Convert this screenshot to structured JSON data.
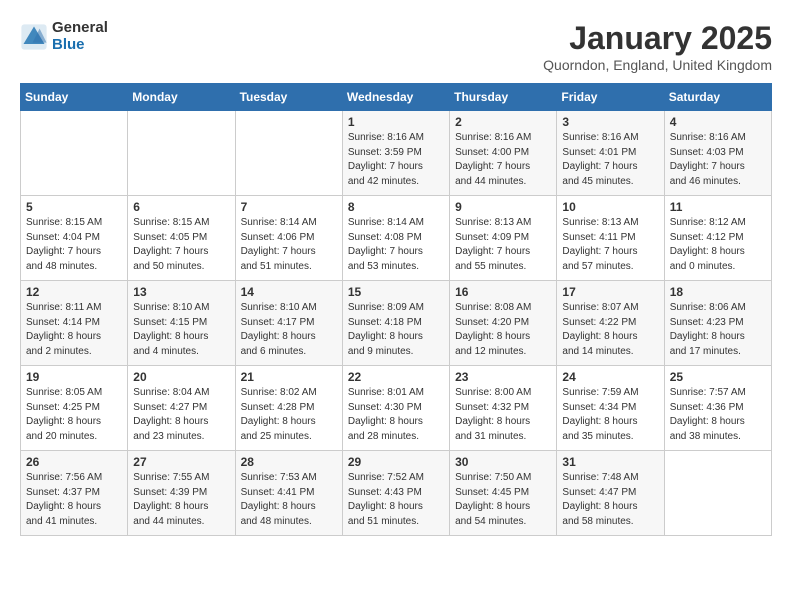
{
  "logo": {
    "general": "General",
    "blue": "Blue"
  },
  "title": "January 2025",
  "location": "Quorndon, England, United Kingdom",
  "days_of_week": [
    "Sunday",
    "Monday",
    "Tuesday",
    "Wednesday",
    "Thursday",
    "Friday",
    "Saturday"
  ],
  "weeks": [
    [
      {
        "day": "",
        "info": ""
      },
      {
        "day": "",
        "info": ""
      },
      {
        "day": "",
        "info": ""
      },
      {
        "day": "1",
        "info": "Sunrise: 8:16 AM\nSunset: 3:59 PM\nDaylight: 7 hours\nand 42 minutes."
      },
      {
        "day": "2",
        "info": "Sunrise: 8:16 AM\nSunset: 4:00 PM\nDaylight: 7 hours\nand 44 minutes."
      },
      {
        "day": "3",
        "info": "Sunrise: 8:16 AM\nSunset: 4:01 PM\nDaylight: 7 hours\nand 45 minutes."
      },
      {
        "day": "4",
        "info": "Sunrise: 8:16 AM\nSunset: 4:03 PM\nDaylight: 7 hours\nand 46 minutes."
      }
    ],
    [
      {
        "day": "5",
        "info": "Sunrise: 8:15 AM\nSunset: 4:04 PM\nDaylight: 7 hours\nand 48 minutes."
      },
      {
        "day": "6",
        "info": "Sunrise: 8:15 AM\nSunset: 4:05 PM\nDaylight: 7 hours\nand 50 minutes."
      },
      {
        "day": "7",
        "info": "Sunrise: 8:14 AM\nSunset: 4:06 PM\nDaylight: 7 hours\nand 51 minutes."
      },
      {
        "day": "8",
        "info": "Sunrise: 8:14 AM\nSunset: 4:08 PM\nDaylight: 7 hours\nand 53 minutes."
      },
      {
        "day": "9",
        "info": "Sunrise: 8:13 AM\nSunset: 4:09 PM\nDaylight: 7 hours\nand 55 minutes."
      },
      {
        "day": "10",
        "info": "Sunrise: 8:13 AM\nSunset: 4:11 PM\nDaylight: 7 hours\nand 57 minutes."
      },
      {
        "day": "11",
        "info": "Sunrise: 8:12 AM\nSunset: 4:12 PM\nDaylight: 8 hours\nand 0 minutes."
      }
    ],
    [
      {
        "day": "12",
        "info": "Sunrise: 8:11 AM\nSunset: 4:14 PM\nDaylight: 8 hours\nand 2 minutes."
      },
      {
        "day": "13",
        "info": "Sunrise: 8:10 AM\nSunset: 4:15 PM\nDaylight: 8 hours\nand 4 minutes."
      },
      {
        "day": "14",
        "info": "Sunrise: 8:10 AM\nSunset: 4:17 PM\nDaylight: 8 hours\nand 6 minutes."
      },
      {
        "day": "15",
        "info": "Sunrise: 8:09 AM\nSunset: 4:18 PM\nDaylight: 8 hours\nand 9 minutes."
      },
      {
        "day": "16",
        "info": "Sunrise: 8:08 AM\nSunset: 4:20 PM\nDaylight: 8 hours\nand 12 minutes."
      },
      {
        "day": "17",
        "info": "Sunrise: 8:07 AM\nSunset: 4:22 PM\nDaylight: 8 hours\nand 14 minutes."
      },
      {
        "day": "18",
        "info": "Sunrise: 8:06 AM\nSunset: 4:23 PM\nDaylight: 8 hours\nand 17 minutes."
      }
    ],
    [
      {
        "day": "19",
        "info": "Sunrise: 8:05 AM\nSunset: 4:25 PM\nDaylight: 8 hours\nand 20 minutes."
      },
      {
        "day": "20",
        "info": "Sunrise: 8:04 AM\nSunset: 4:27 PM\nDaylight: 8 hours\nand 23 minutes."
      },
      {
        "day": "21",
        "info": "Sunrise: 8:02 AM\nSunset: 4:28 PM\nDaylight: 8 hours\nand 25 minutes."
      },
      {
        "day": "22",
        "info": "Sunrise: 8:01 AM\nSunset: 4:30 PM\nDaylight: 8 hours\nand 28 minutes."
      },
      {
        "day": "23",
        "info": "Sunrise: 8:00 AM\nSunset: 4:32 PM\nDaylight: 8 hours\nand 31 minutes."
      },
      {
        "day": "24",
        "info": "Sunrise: 7:59 AM\nSunset: 4:34 PM\nDaylight: 8 hours\nand 35 minutes."
      },
      {
        "day": "25",
        "info": "Sunrise: 7:57 AM\nSunset: 4:36 PM\nDaylight: 8 hours\nand 38 minutes."
      }
    ],
    [
      {
        "day": "26",
        "info": "Sunrise: 7:56 AM\nSunset: 4:37 PM\nDaylight: 8 hours\nand 41 minutes."
      },
      {
        "day": "27",
        "info": "Sunrise: 7:55 AM\nSunset: 4:39 PM\nDaylight: 8 hours\nand 44 minutes."
      },
      {
        "day": "28",
        "info": "Sunrise: 7:53 AM\nSunset: 4:41 PM\nDaylight: 8 hours\nand 48 minutes."
      },
      {
        "day": "29",
        "info": "Sunrise: 7:52 AM\nSunset: 4:43 PM\nDaylight: 8 hours\nand 51 minutes."
      },
      {
        "day": "30",
        "info": "Sunrise: 7:50 AM\nSunset: 4:45 PM\nDaylight: 8 hours\nand 54 minutes."
      },
      {
        "day": "31",
        "info": "Sunrise: 7:48 AM\nSunset: 4:47 PM\nDaylight: 8 hours\nand 58 minutes."
      },
      {
        "day": "",
        "info": ""
      }
    ]
  ]
}
